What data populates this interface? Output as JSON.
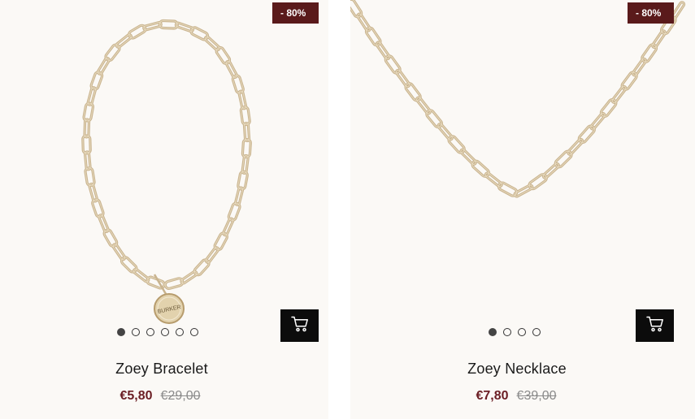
{
  "colors": {
    "badge_bg": "#5a1a1b",
    "price_sale": "#6b1e24",
    "price_old": "#8a8a8a",
    "cart_bg": "#0c0c0c",
    "card_bg": "#fbf9f6",
    "gold": "#c8b28d"
  },
  "products": [
    {
      "name": "Zoey Bracelet",
      "badge": "- 80%",
      "price_sale": "€5,80",
      "price_original": "€29,00",
      "tag_text": "BURKER",
      "image_dots": 6,
      "active_dot": 0,
      "cart_icon": "cart-icon"
    },
    {
      "name": "Zoey Necklace",
      "badge": "- 80%",
      "price_sale": "€7,80",
      "price_original": "€39,00",
      "image_dots": 4,
      "active_dot": 0,
      "cart_icon": "cart-icon"
    }
  ]
}
